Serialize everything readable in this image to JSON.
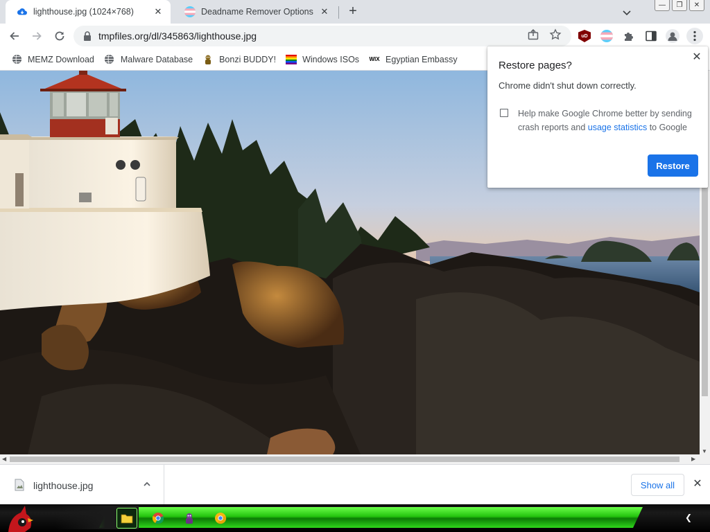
{
  "tabs": [
    {
      "title": "lighthouse.jpg (1024×768)",
      "active": true
    },
    {
      "title": "Deadname Remover Options",
      "active": false
    }
  ],
  "toolbar": {
    "url": "tmpfiles.org/dl/345863/lighthouse.jpg",
    "extension_ublock_label": "uD"
  },
  "bookmarks": [
    {
      "label": "MEMZ Download",
      "icon": "globe-icon"
    },
    {
      "label": "Malware Database",
      "icon": "globe-icon"
    },
    {
      "label": "Bonzi BUDDY!",
      "icon": "bonzi-icon"
    },
    {
      "label": "Windows ISOs",
      "icon": "rainbow-flag-icon"
    },
    {
      "label": "Egyptian Embassy",
      "icon": "wix-icon",
      "icon_text": "WIX"
    }
  ],
  "popup": {
    "title": "Restore pages?",
    "message": "Chrome didn't shut down correctly.",
    "help_prefix": "Help make Google Chrome better by sending crash reports and ",
    "help_link": "usage statistics",
    "help_suffix": " to Google",
    "restore_label": "Restore",
    "checkbox_checked": false
  },
  "downloads": {
    "file_name": "lighthouse.jpg",
    "show_all_label": "Show all"
  },
  "colors": {
    "accent": "#1a73e8",
    "tabstrip": "#dee1e6",
    "taskbar_green": "#24c40e"
  }
}
